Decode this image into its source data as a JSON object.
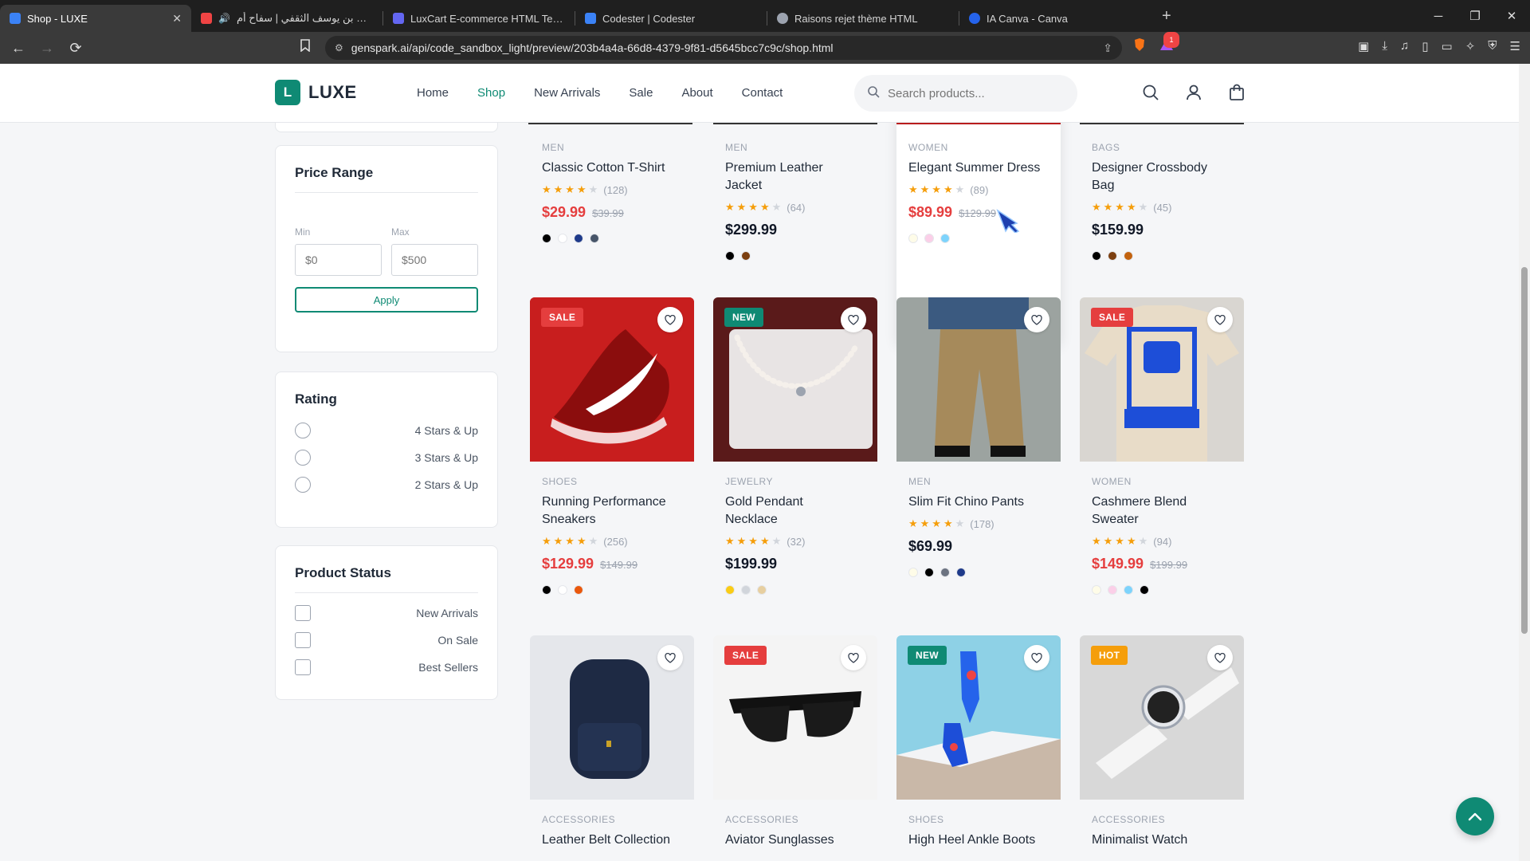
{
  "browser": {
    "tabs": [
      {
        "label": "Shop - LUXE",
        "color": "#3b82f6",
        "active": true
      },
      {
        "label": "الحجاج بن يوسف الثقفي | سفاح أم",
        "color": "#ef4444"
      },
      {
        "label": "LuxCart E-commerce HTML Template",
        "color": "#6366f1"
      },
      {
        "label": "Codester | Codester",
        "color": "#3b82f6"
      },
      {
        "label": "Raisons rejet thème HTML",
        "color": "#9ca3af"
      },
      {
        "label": "IA Canva - Canva",
        "color": "#2563eb"
      }
    ],
    "url": "genspark.ai/api/code_sandbox_light/preview/203b4a4a-66d8-4379-9f81-d5645bcc7c9c/shop.html",
    "extension_badge": "1"
  },
  "header": {
    "logo_letter": "L",
    "logo_text": "LUXE",
    "nav": [
      "Home",
      "Shop",
      "New Arrivals",
      "Sale",
      "About",
      "Contact"
    ],
    "active_nav": "Shop",
    "search_placeholder": "Search products..."
  },
  "filters": {
    "price": {
      "title": "Price Range",
      "min_label": "Min",
      "max_label": "Max",
      "min_placeholder": "$0",
      "max_placeholder": "$500",
      "apply": "Apply"
    },
    "rating": {
      "title": "Rating",
      "options": [
        "4 Stars & Up",
        "3 Stars & Up",
        "2 Stars & Up"
      ]
    },
    "status": {
      "title": "Product Status",
      "options": [
        "New Arrivals",
        "On Sale",
        "Best Sellers"
      ]
    }
  },
  "products": [
    {
      "category": "MEN",
      "name": "Classic Cotton T-Shirt",
      "stars": 4,
      "reviews": "(128)",
      "price": "$29.99",
      "old_price": "$39.99",
      "colors": [
        "#000000",
        "#ffffff",
        "#1e3a8a",
        "#475569"
      ]
    },
    {
      "category": "MEN",
      "name": "Premium Leather Jacket",
      "stars": 4,
      "reviews": "(64)",
      "price": "$299.99",
      "old_price": "",
      "colors": [
        "#000000",
        "#7c3f10"
      ]
    },
    {
      "category": "WOMEN",
      "name": "Elegant Summer Dress",
      "stars": 4,
      "reviews": "(89)",
      "price": "$89.99",
      "old_price": "$129.99",
      "colors": [
        "#fefce8",
        "#fbcfe8",
        "#7dd3fc"
      ]
    },
    {
      "category": "BAGS",
      "name": "Designer Crossbody Bag",
      "stars": 4,
      "reviews": "(45)",
      "price": "$159.99",
      "old_price": "",
      "colors": [
        "#000000",
        "#7c3f10",
        "#c2620e"
      ]
    },
    {
      "category": "SHOES",
      "name": "Running Performance Sneakers",
      "stars": 4,
      "reviews": "(256)",
      "price": "$129.99",
      "old_price": "$149.99",
      "colors": [
        "#000000",
        "#ffffff",
        "#ea580c"
      ],
      "badge": "SALE",
      "badge_type": "sale"
    },
    {
      "category": "JEWELRY",
      "name": "Gold Pendant Necklace",
      "stars": 4,
      "reviews": "(32)",
      "price": "$199.99",
      "old_price": "",
      "colors": [
        "#facc15",
        "#d1d5db",
        "#e7cfa0"
      ],
      "badge": "NEW",
      "badge_type": "new"
    },
    {
      "category": "MEN",
      "name": "Slim Fit Chino Pants",
      "stars": 4,
      "reviews": "(178)",
      "price": "$69.99",
      "old_price": "",
      "colors": [
        "#fefce8",
        "#000000",
        "#6b7280",
        "#1e3a8a"
      ]
    },
    {
      "category": "WOMEN",
      "name": "Cashmere Blend Sweater",
      "stars": 4,
      "reviews": "(94)",
      "price": "$149.99",
      "old_price": "$199.99",
      "colors": [
        "#fefce8",
        "#fbcfe8",
        "#7dd3fc",
        "#000000"
      ],
      "badge": "SALE",
      "badge_type": "sale"
    },
    {
      "category": "ACCESSORIES",
      "name": "Leather Belt Collection",
      "badge": ""
    },
    {
      "category": "ACCESSORIES",
      "name": "Aviator Sunglasses",
      "badge": "SALE",
      "badge_type": "sale"
    },
    {
      "category": "SHOES",
      "name": "High Heel Ankle Boots",
      "badge": "NEW",
      "badge_type": "new"
    },
    {
      "category": "ACCESSORIES",
      "name": "Minimalist Watch",
      "badge": "HOT",
      "badge_type": "hot"
    }
  ]
}
